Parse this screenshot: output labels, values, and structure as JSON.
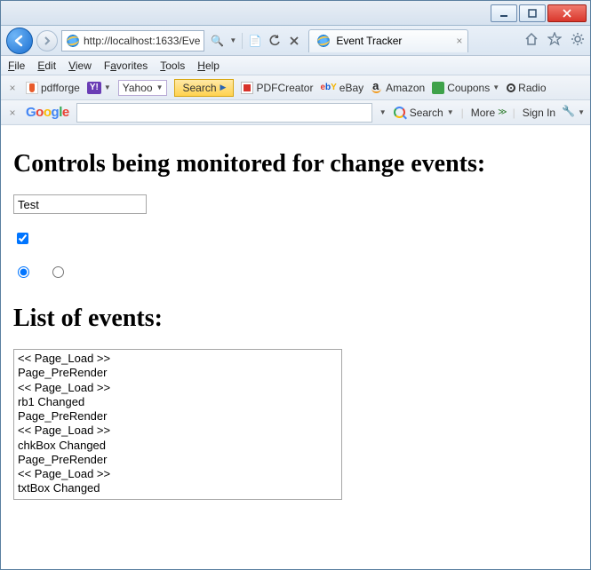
{
  "window": {
    "url": "http://localhost:1633/Eve",
    "tab_title": "Event Tracker"
  },
  "menubar": {
    "file": "File",
    "edit": "Edit",
    "view": "View",
    "favorites": "Favorites",
    "tools": "Tools",
    "help": "Help"
  },
  "toolbar1": {
    "pdfforge": "pdfforge",
    "yahoo": "Yahoo",
    "search": "Search",
    "pdfcreator": "PDFCreator",
    "ebay": "eBay",
    "amazon": "Amazon",
    "coupons": "Coupons",
    "radio": "Radio"
  },
  "toolbar2": {
    "search_label": "Search",
    "more_label": "More",
    "signin_label": "Sign In"
  },
  "page": {
    "heading1": "Controls being monitored for change events:",
    "textbox_value": "Test",
    "heading2": "List of events:",
    "events": [
      "<< Page_Load >>",
      "Page_PreRender",
      "<< Page_Load >>",
      "rb1 Changed",
      "Page_PreRender",
      "<< Page_Load >>",
      "chkBox Changed",
      "Page_PreRender",
      "<< Page_Load >>",
      "txtBox Changed"
    ]
  }
}
